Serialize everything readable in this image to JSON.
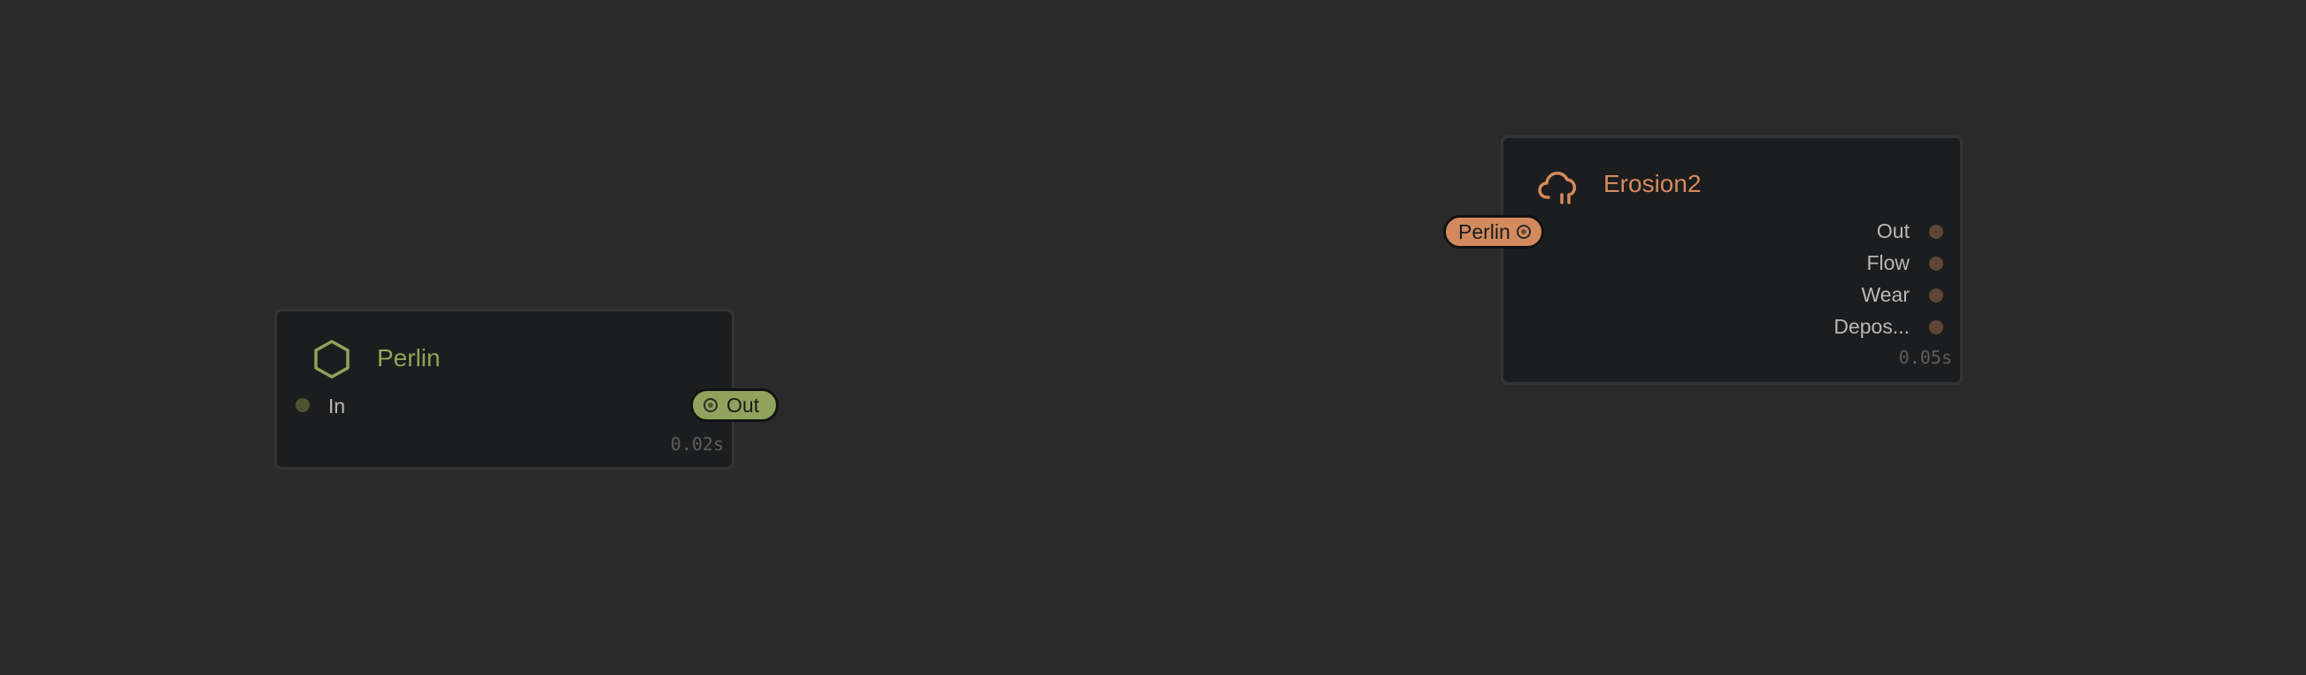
{
  "colors": {
    "background": "#2a2a2a",
    "node_body": "#1c1d1e",
    "node_border": "#333435",
    "perlin_accent": "#8fa35c",
    "erosion_accent": "#d38a5e",
    "perlin_port": "#4d5233",
    "erosion_port": "#5e4536",
    "label": "#b9b9b9",
    "timing": "#5e5e5e"
  },
  "nodes": {
    "perlin": {
      "title": "Perlin",
      "icon": "hexagon-icon",
      "input_label": "In",
      "output_label": "Out",
      "timing": "0.02s"
    },
    "erosion": {
      "title": "Erosion2",
      "icon": "cloud-rain-icon",
      "input_label": "Perlin",
      "outputs": [
        "Out",
        "Flow",
        "Wear",
        "Depos..."
      ],
      "timing": "0.05s"
    }
  }
}
